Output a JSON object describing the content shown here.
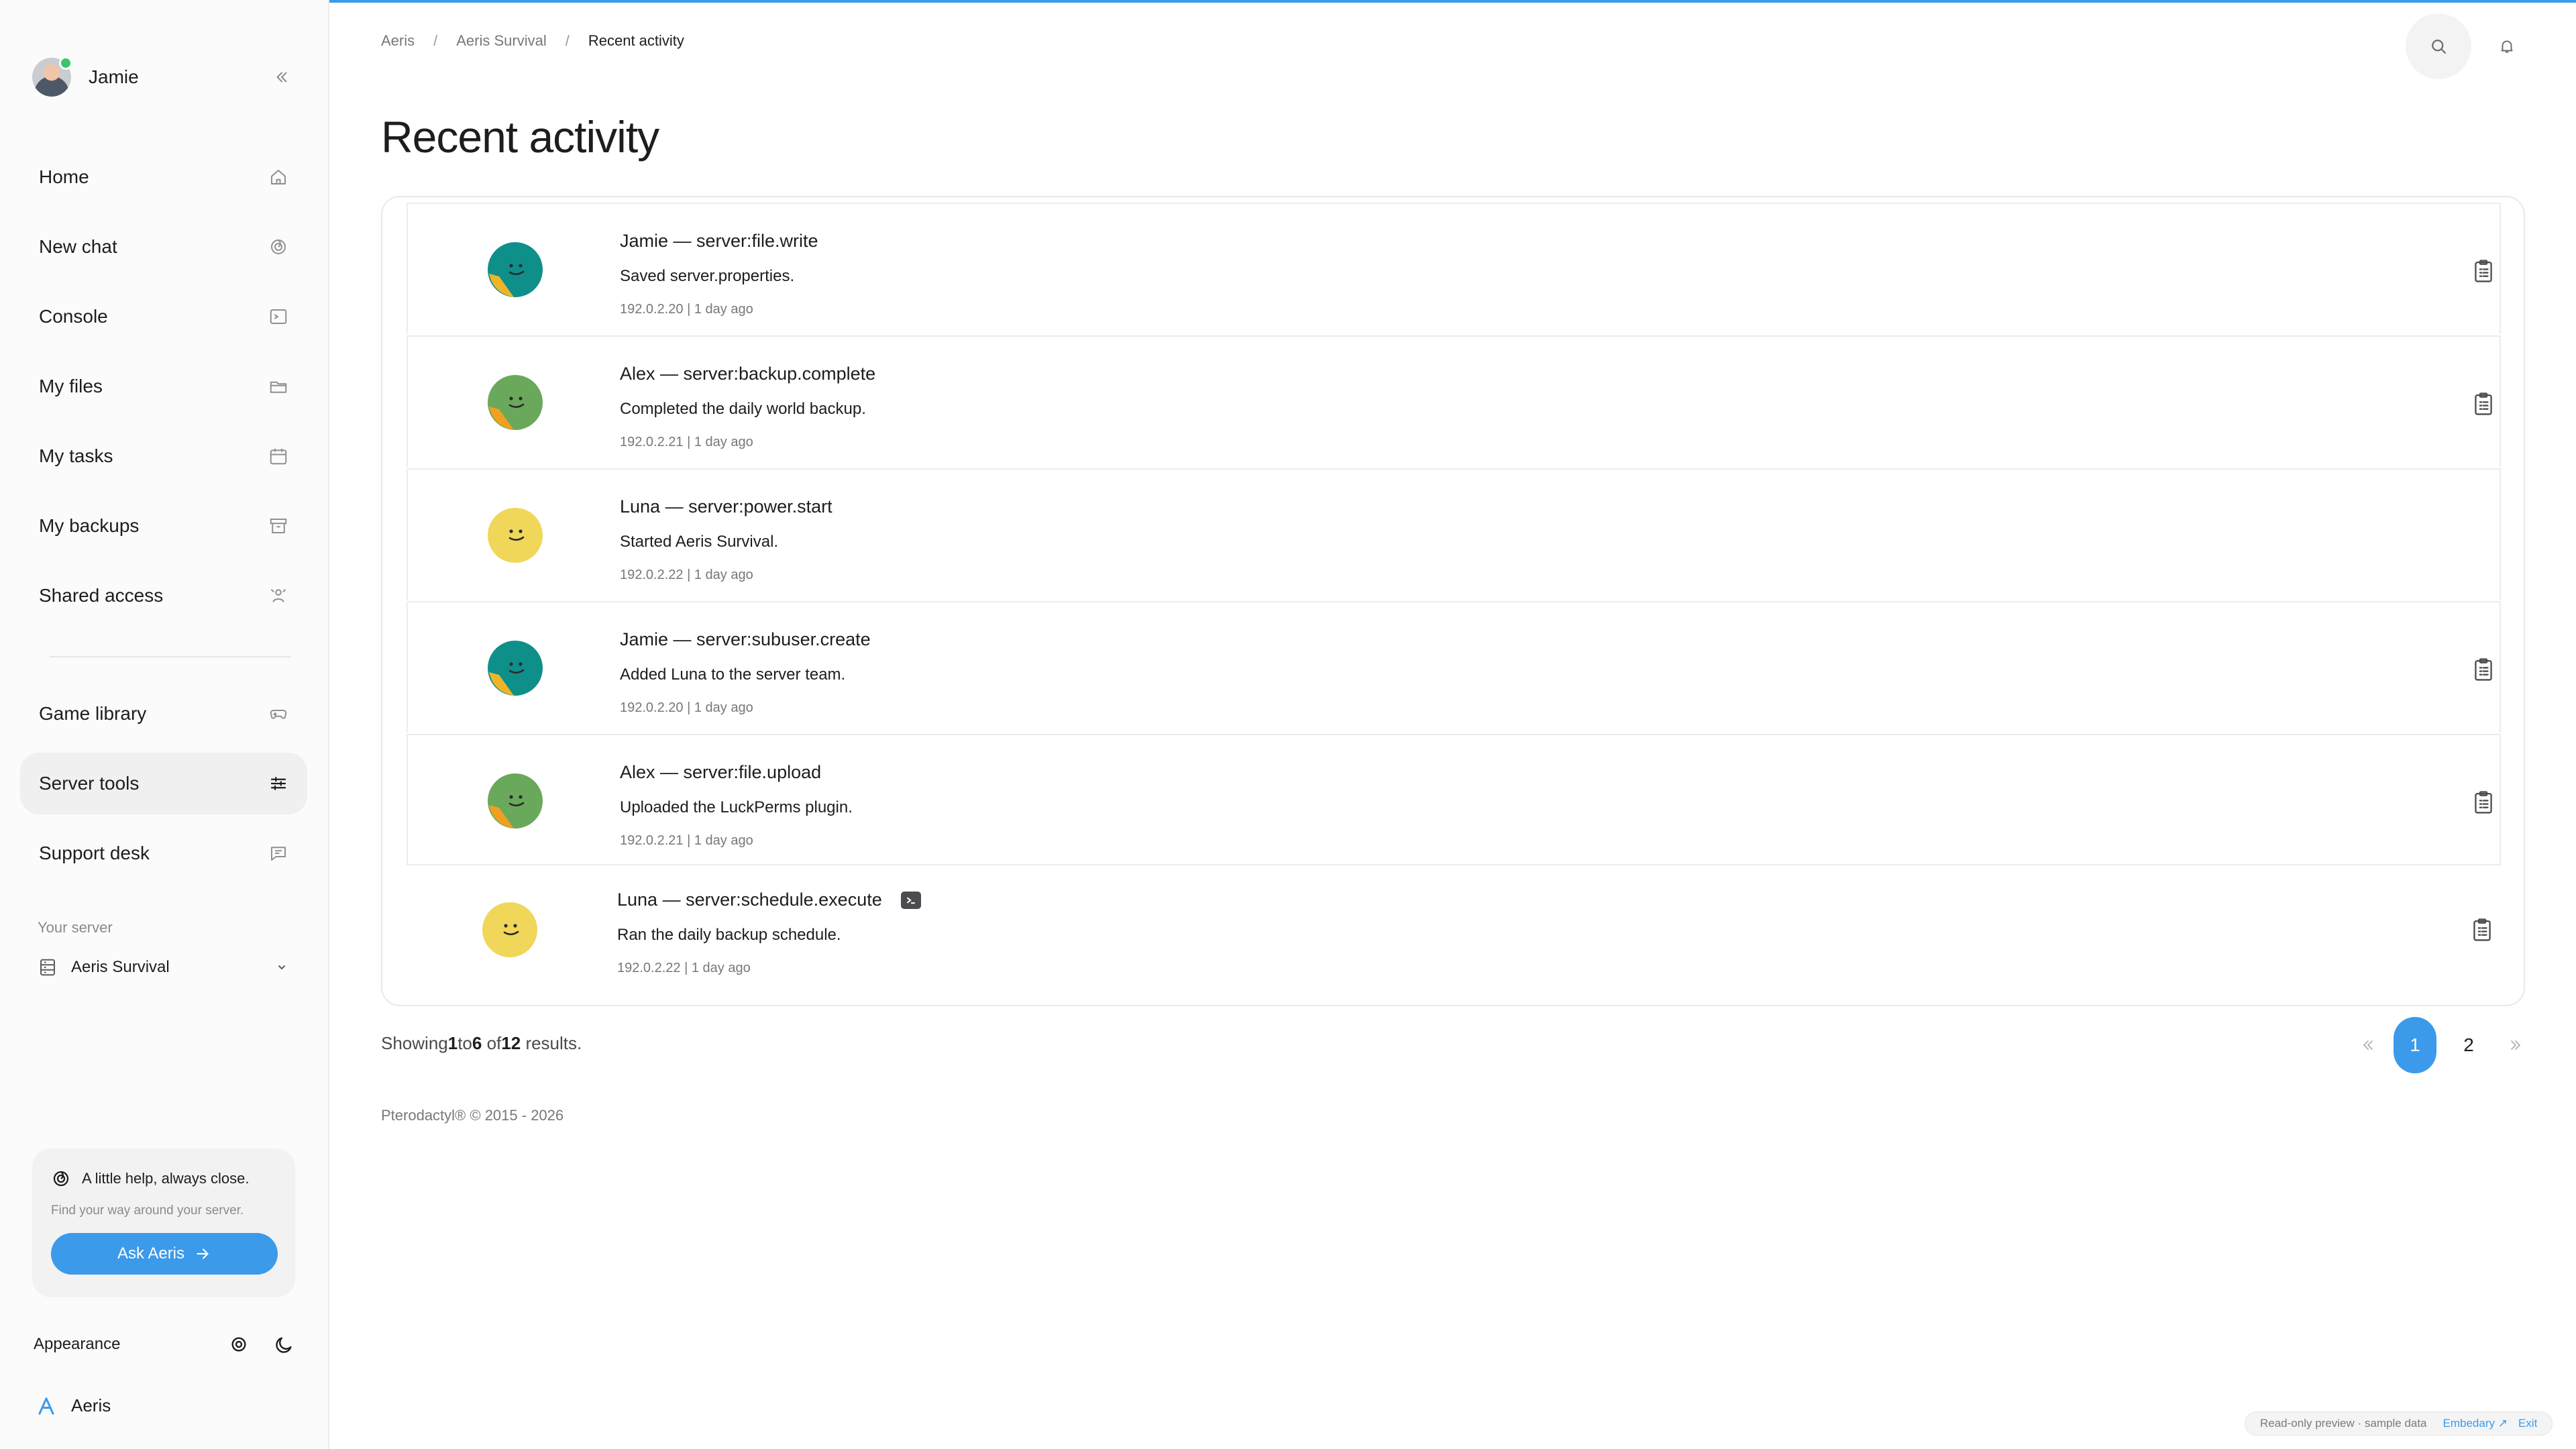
{
  "sidebar": {
    "user_name": "Jamie",
    "nav": [
      {
        "label": "Home",
        "icon": "home-icon"
      },
      {
        "label": "New chat",
        "icon": "chat-swirl-icon"
      },
      {
        "label": "Console",
        "icon": "terminal-icon"
      },
      {
        "label": "My files",
        "icon": "folder-icon"
      },
      {
        "label": "My tasks",
        "icon": "calendar-icon"
      },
      {
        "label": "My backups",
        "icon": "archive-icon"
      },
      {
        "label": "Shared access",
        "icon": "users-icon"
      }
    ],
    "nav2": [
      {
        "label": "Game library",
        "icon": "gamepad-icon"
      },
      {
        "label": "Server tools",
        "icon": "sliders-icon",
        "active": true
      },
      {
        "label": "Support desk",
        "icon": "message-icon"
      }
    ],
    "server_label": "Your server",
    "server_name": "Aeris Survival",
    "help": {
      "title": "A little help, always close.",
      "subtitle": "Find your way around your server.",
      "button": "Ask Aeris"
    },
    "appearance_label": "Appearance",
    "brand": "Aeris"
  },
  "breadcrumb": [
    "Aeris",
    "Aeris Survival",
    "Recent activity"
  ],
  "page_title": "Recent activity",
  "activity": [
    {
      "title": "Jamie — server:file.write",
      "desc": "Saved server.properties.",
      "meta": "192.0.2.20 | 1 day ago",
      "color": "#0f8f8a",
      "clip": true,
      "console": false
    },
    {
      "title": "Alex — server:backup.complete",
      "desc": "Completed the daily world backup.",
      "meta": "192.0.2.21 | 1 day ago",
      "color": "#6aa85b",
      "clip": true,
      "console": false
    },
    {
      "title": "Luna — server:power.start",
      "desc": "Started Aeris Survival.",
      "meta": "192.0.2.22 | 1 day ago",
      "color": "#f0d75a",
      "clip": false,
      "console": false
    },
    {
      "title": "Jamie — server:subuser.create",
      "desc": "Added Luna to the server team.",
      "meta": "192.0.2.20 | 1 day ago",
      "color": "#0f8f8a",
      "clip": true,
      "console": false
    },
    {
      "title": "Alex — server:file.upload",
      "desc": "Uploaded the LuckPerms plugin.",
      "meta": "192.0.2.21 | 1 day ago",
      "color": "#6aa85b",
      "clip": true,
      "console": false
    },
    {
      "title": "Luna — server:schedule.execute",
      "desc": "Ran the daily backup schedule.",
      "meta": "192.0.2.22 | 1 day ago",
      "color": "#f0d75a",
      "clip": true,
      "console": true
    }
  ],
  "results": {
    "prefix": "Showing",
    "from": "1",
    "to_word": "to",
    "to": "6",
    "of_word": "of",
    "total": "12",
    "suffix": "results."
  },
  "pagination": {
    "pages": [
      "1",
      "2"
    ],
    "current": "1"
  },
  "footer": "Pterodactyl® © 2015 - 2026",
  "preview": {
    "text": "Read-only preview · sample data",
    "link": "Embedary ↗",
    "exit": "Exit"
  },
  "colors": {
    "accent": "#3b9aea"
  }
}
